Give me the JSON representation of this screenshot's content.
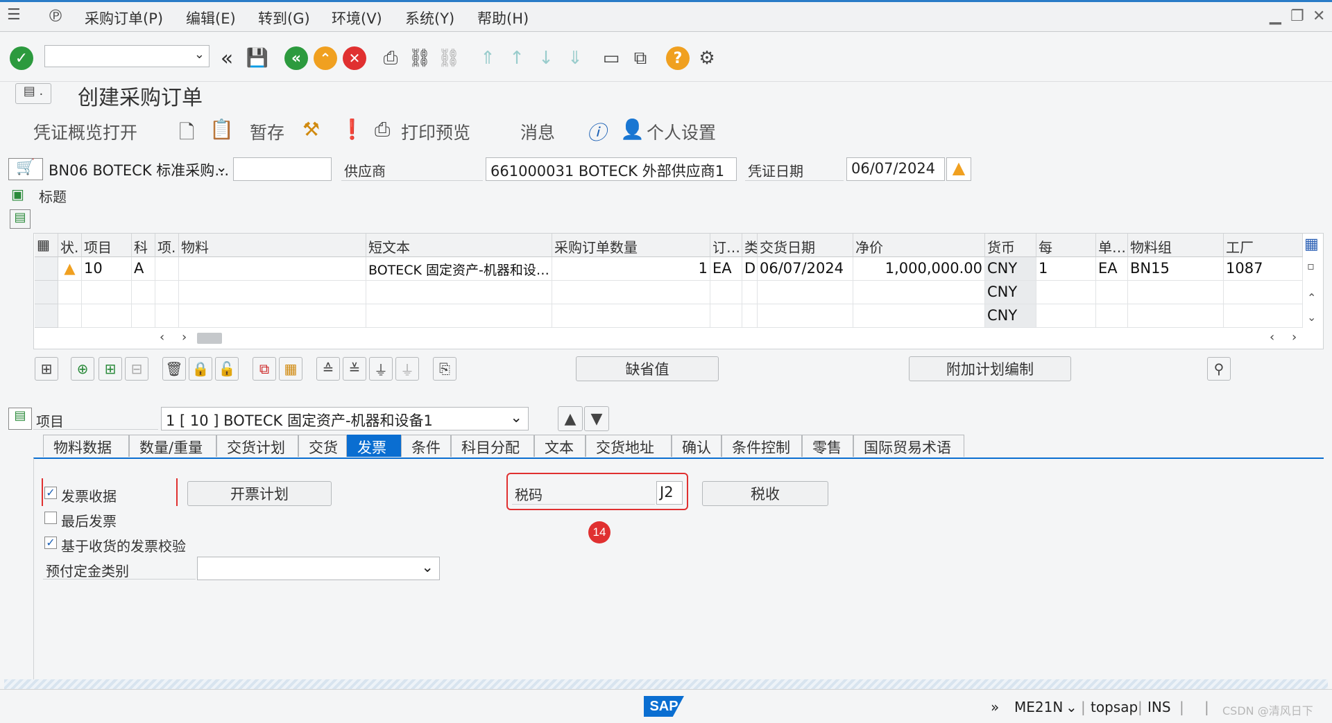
{
  "menubar": {
    "items": [
      "采购订单(P)",
      "编辑(E)",
      "转到(G)",
      "环境(V)",
      "系统(Y)",
      "帮助(H)"
    ]
  },
  "toolbar": {
    "command_field": "",
    "icons": [
      "enter-icon",
      "back-double-icon",
      "save-icon",
      "back-icon",
      "exit-icon",
      "cancel-icon",
      "print-icon",
      "find-icon",
      "find-next-icon",
      "first-page-icon",
      "prev-page-icon",
      "next-page-icon",
      "last-page-icon",
      "new-session-icon",
      "shortcut-icon",
      "help-icon",
      "settings-icon"
    ]
  },
  "title": "创建采购订单",
  "app_toolbar": {
    "doc_overview": "凭证概览打开",
    "hold": "暂存",
    "print_preview": "打印预览",
    "messages": "消息",
    "personal_settings": "个人设置"
  },
  "header": {
    "order_type": "BN06 BOTECK 标准采购…",
    "order_number": "",
    "vendor_label": "供应商",
    "vendor_value": "661000031 BOTECK 外部供应商1",
    "doc_date_label": "凭证日期",
    "doc_date_value": "06/07/2024",
    "section_label": "标题"
  },
  "grid": {
    "columns": [
      "状.",
      "项目",
      "科",
      "项.",
      "物料",
      "短文本",
      "采购订单数量",
      "订…",
      "类",
      "交货日期",
      "净价",
      "货币",
      "每",
      "单…",
      "物料组",
      "工厂"
    ],
    "rows": [
      {
        "item": "10",
        "acct": "A",
        "cat": "",
        "material": "",
        "short_text": "BOTECK 固定资产-机器和设…",
        "qty": "1",
        "oun": "EA",
        "dci": "D",
        "delivery_date": "06/07/2024",
        "net_price": "1,000,000.00",
        "currency": "CNY",
        "per": "1",
        "unit": "EA",
        "mat_group": "BN15",
        "plant": "1087"
      },
      {
        "currency": "CNY"
      },
      {
        "currency": "CNY"
      }
    ]
  },
  "buttons": {
    "default_values": "缺省值",
    "additional_planning": "附加计划编制"
  },
  "item_detail": {
    "label": "项目",
    "selected": "1 [ 10 ] BOTECK 固定资产-机器和设备1"
  },
  "tabs": [
    "物料数据",
    "数量/重量",
    "交货计划",
    "交货",
    "发票",
    "条件",
    "科目分配",
    "文本",
    "交货地址",
    "确认",
    "条件控制",
    "零售",
    "国际贸易术语"
  ],
  "active_tab": "发票",
  "invoice_tab": {
    "invoice_receipt": "发票收据",
    "final_invoice": "最后发票",
    "gr_based_iv": "基于收货的发票校验",
    "dp_category_label": "预付定金类别",
    "dp_category_value": "",
    "invoicing_plan": "开票计划",
    "tax_code_label": "税码",
    "tax_code_value": "J2",
    "taxes_button": "税收",
    "annotation_number": "14"
  },
  "statusbar": {
    "transaction": "ME21N",
    "server": "topsap",
    "mode": "INS",
    "watermark": "CSDN @清风日下"
  }
}
